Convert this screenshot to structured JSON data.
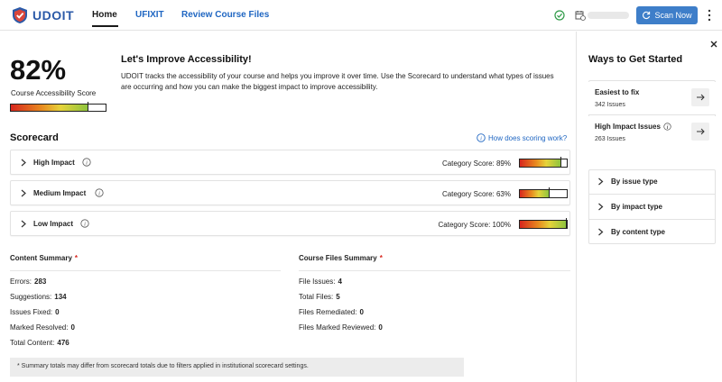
{
  "app": {
    "name": "UDOIT"
  },
  "nav": {
    "home": "Home",
    "ufixit": "UFIXIT",
    "review": "Review Course Files"
  },
  "header": {
    "scan_label": "Scan Now"
  },
  "score": {
    "percent": "82%",
    "value": 0.82,
    "label": "Course Accessibility Score"
  },
  "intro": {
    "title": "Let's Improve Accessibility!",
    "text": "UDOIT tracks the accessibility of your course and helps you improve it over time. Use the Scorecard to understand what types of issues are occurring and how you can make the biggest impact to improve accessibility."
  },
  "scorecard": {
    "title": "Scorecard",
    "help_link": "How does scoring work?",
    "categories": [
      {
        "label": "High Impact",
        "score_text": "Category Score: 89%",
        "value": 0.89
      },
      {
        "label": "Medium Impact",
        "score_text": "Category Score: 63%",
        "value": 0.63
      },
      {
        "label": "Low Impact",
        "score_text": "Category Score: 100%",
        "value": 1.0
      }
    ]
  },
  "content_summary": {
    "title": "Content Summary",
    "star": "*",
    "rows": [
      {
        "label": "Errors:",
        "value": "283"
      },
      {
        "label": "Suggestions:",
        "value": "134"
      },
      {
        "label": "Issues Fixed:",
        "value": "0"
      },
      {
        "label": "Marked Resolved:",
        "value": "0"
      },
      {
        "label": "Total Content:",
        "value": "476"
      }
    ]
  },
  "files_summary": {
    "title": "Course Files Summary",
    "star": "*",
    "rows": [
      {
        "label": "File Issues:",
        "value": "4"
      },
      {
        "label": "Total Files:",
        "value": "5"
      },
      {
        "label": "Files Remediated:",
        "value": "0"
      },
      {
        "label": "Files Marked Reviewed:",
        "value": "0"
      }
    ]
  },
  "footnote": "* Summary totals may differ from scorecard totals due to filters applied in institutional scorecard settings.",
  "panel": {
    "title": "Ways to Get Started",
    "quick": [
      {
        "title": "Easiest to fix",
        "sub": "342 Issues"
      },
      {
        "title": "High Impact Issues",
        "sub": "263 Issues"
      }
    ],
    "filters": [
      {
        "label": "By issue type"
      },
      {
        "label": "By impact type"
      },
      {
        "label": "By content type"
      }
    ]
  },
  "colors": {
    "accent": "#1f66c2",
    "button": "#3e7ec9",
    "required": "#d7261e"
  }
}
